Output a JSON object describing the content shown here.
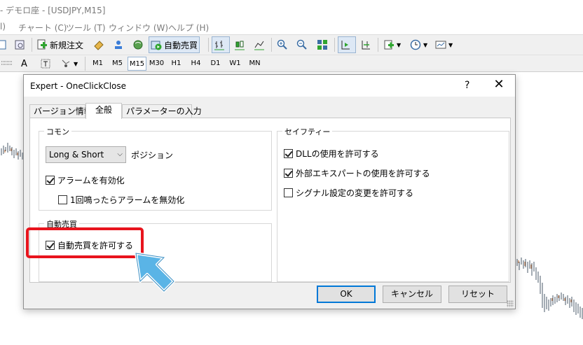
{
  "window": {
    "title": "- デモロ座 - [USDJPY,M15]"
  },
  "menu": [
    {
      "label": "l)"
    },
    {
      "label": "チャート (C)"
    },
    {
      "label": "ツール (T)"
    },
    {
      "label": "ウィンドウ (W)"
    },
    {
      "label": "ヘルプ (H)"
    }
  ],
  "toolbar": {
    "new_order_label": "新規注文",
    "auto_trade_label": "自動売買"
  },
  "timeframes": [
    "M1",
    "M5",
    "M15",
    "M30",
    "H1",
    "H4",
    "D1",
    "W1",
    "MN"
  ],
  "active_timeframe": "M15",
  "dialog": {
    "title": "Expert - OneClickClose",
    "help_label": "?",
    "close_label": "✕",
    "tabs": [
      {
        "label": "バージョン情報",
        "selected": false
      },
      {
        "label": "全般",
        "selected": true
      },
      {
        "label": "パラメーターの入力",
        "selected": false
      }
    ],
    "common": {
      "group_label": "コモン",
      "position_select_value": "Long & Short",
      "position_label": "ポジション",
      "enable_alerts_label": "アラームを有効化",
      "enable_alerts_checked": true,
      "disable_alert_after_one_label": "1回鳴ったらアラームを無効化",
      "disable_alert_after_one_checked": false
    },
    "auto_trading": {
      "group_label": "自動売買",
      "allow_auto_trading_label": "自動売買を許可する",
      "allow_auto_trading_checked": true
    },
    "safety": {
      "group_label": "セイフティー",
      "allow_dll_label": "DLLの使用を許可する",
      "allow_dll_checked": true,
      "allow_external_experts_label": "外部エキスパートの使用を許可する",
      "allow_external_experts_checked": true,
      "allow_signal_changes_label": "シグナル設定の変更を許可する",
      "allow_signal_changes_checked": false
    },
    "buttons": {
      "ok": "OK",
      "cancel": "キャンセル",
      "reset": "リセット"
    }
  },
  "colors": {
    "highlight_red": "#e8141d",
    "arrow_blue": "#5ab4e6",
    "default_button_border": "#0078d7"
  }
}
